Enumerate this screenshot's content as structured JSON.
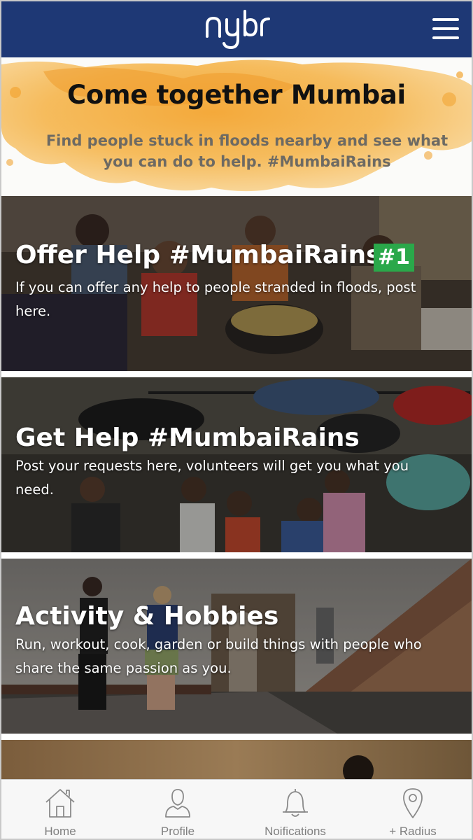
{
  "header": {
    "logo_text": "nybr",
    "menu_icon": "hamburger-menu-icon",
    "background_color": "#1e3875"
  },
  "hero": {
    "title": "Come together Mumbai",
    "subtitle": "Find people stuck in floods nearby and see what you can do to help. #MumbaiRains",
    "accent_color": "#f2a533"
  },
  "cards": [
    {
      "title": "Offer Help #MumbaiRains",
      "badge": "#1",
      "description": "If you can offer any help to people stranded in floods, post here."
    },
    {
      "title": "Get Help #MumbaiRains",
      "description": "Post your requests here, volunteers will get you what you need."
    },
    {
      "title": "Activity & Hobbies",
      "description": "Run, workout, cook, garden or build things with people who share the same passion as you."
    }
  ],
  "tabbar": {
    "tabs": [
      {
        "label": "Home",
        "icon": "home-icon"
      },
      {
        "label": "Profile",
        "icon": "profile-icon"
      },
      {
        "label": "Noifications",
        "icon": "bell-icon"
      },
      {
        "label": "+ Radius",
        "icon": "location-pin-icon"
      }
    ]
  }
}
